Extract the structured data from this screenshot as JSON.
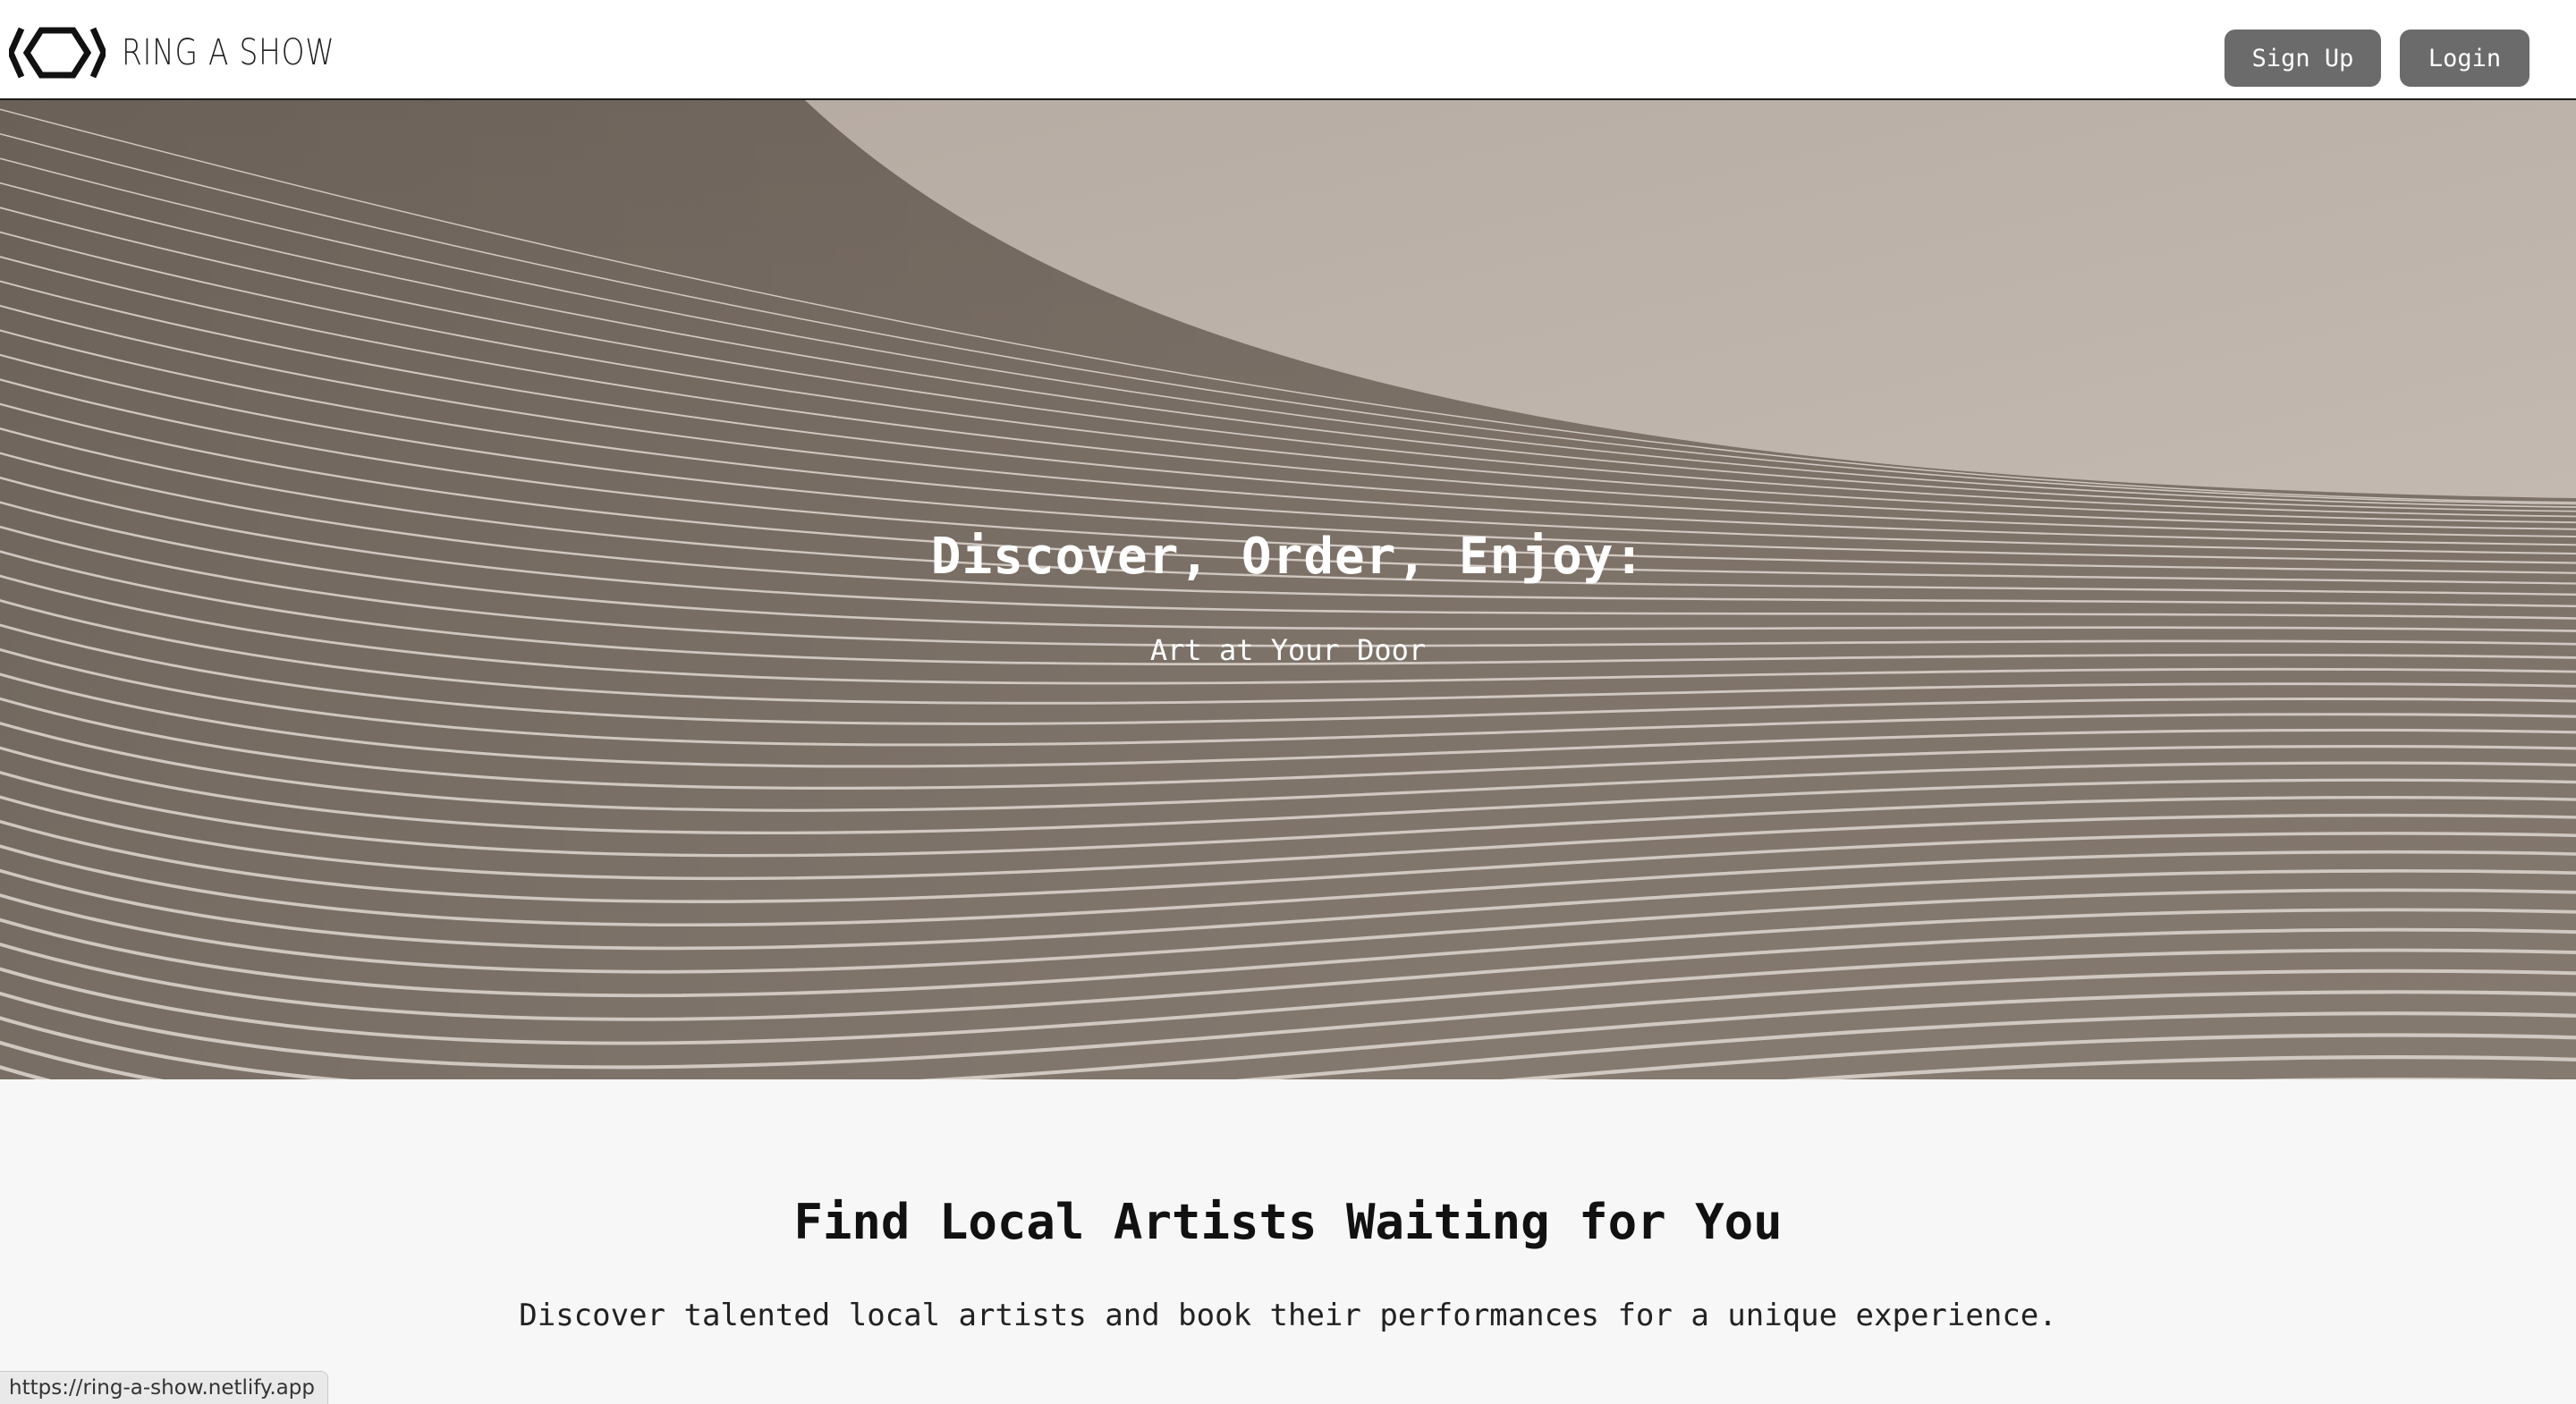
{
  "brand": {
    "name": "RING A SHOW",
    "logo_icon": "hexagon-brackets-icon"
  },
  "nav": {
    "signup_label": "Sign Up",
    "login_label": "Login"
  },
  "hero": {
    "title": "Discover, Order, Enjoy:",
    "subtitle": "Art at Your Door",
    "colors": {
      "sky": "#bfb4ab",
      "surface": "#7d7268",
      "lines": "#d8d1ca"
    }
  },
  "section": {
    "title": "Find Local Artists Waiting for You",
    "text": "Discover talented local artists and book their performances for a unique experience."
  },
  "status_bar": {
    "url": "https://ring-a-show.netlify.app"
  },
  "colors": {
    "button_bg": "#6b6b6b",
    "button_text": "#ffffff",
    "page_bg": "#f7f7f7",
    "header_bg": "#ffffff"
  }
}
